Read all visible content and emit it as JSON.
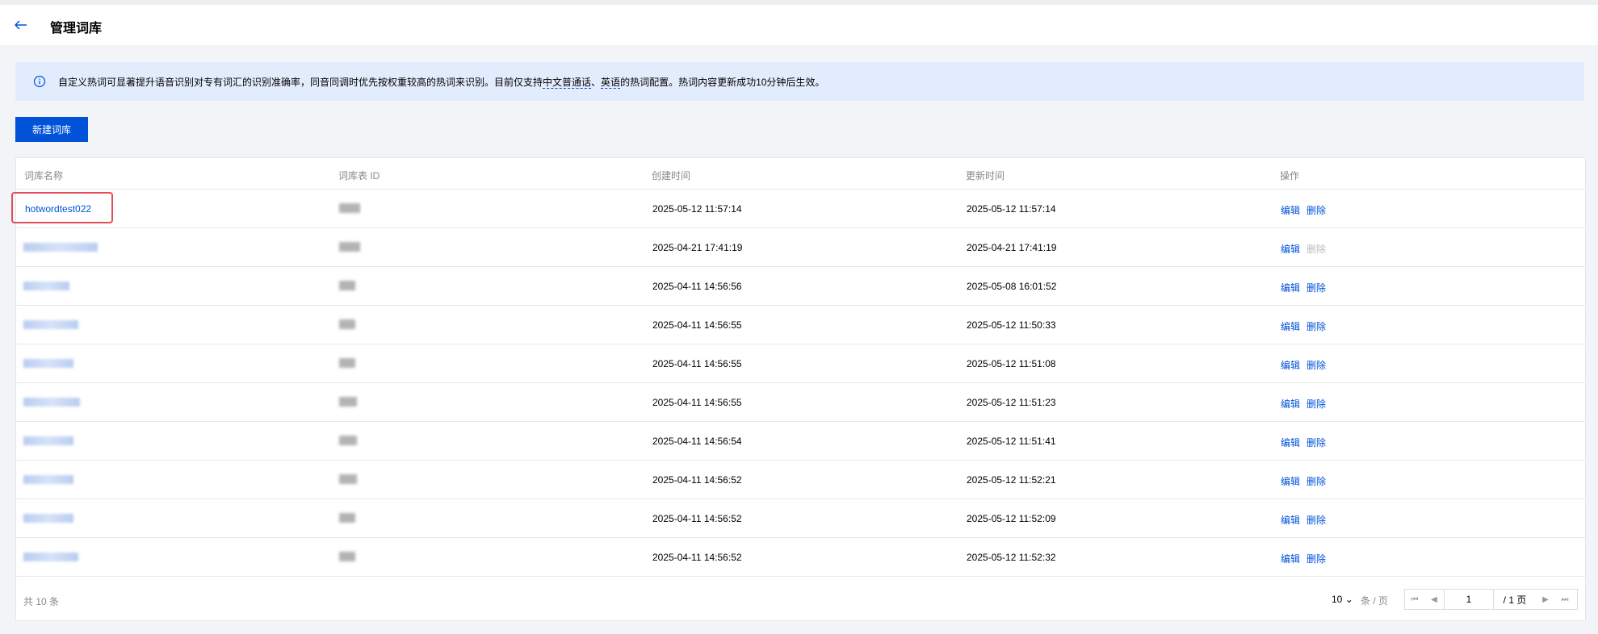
{
  "header": {
    "title": "管理词库"
  },
  "notice": {
    "text_before": "自定义热词可显著提升语音识别对专有词汇的识别准确率，同音同调时优先按权重较高的热词来识别。目前仅支持",
    "lang1": "中文普通话",
    "sep": "、",
    "lang2": "英语",
    "text_after": "的热词配置。热词内容更新成功10分钟后生效。"
  },
  "toolbar": {
    "create_label": "新建词库"
  },
  "table": {
    "columns": [
      "词库名称",
      "词库表 ID",
      "创建时间",
      "更新时间",
      "操作"
    ],
    "rows": [
      {
        "name": "hotwordtest022",
        "created": "2025-05-12 11:57:14",
        "updated": "2025-05-12 11:57:14",
        "edit": "编辑",
        "delete": "删除",
        "delete_disabled": false
      },
      {
        "name": "",
        "created": "2025-04-21 17:41:19",
        "updated": "2025-04-21 17:41:19",
        "edit": "编辑",
        "delete": "删除",
        "delete_disabled": true
      },
      {
        "name": "",
        "created": "2025-04-11 14:56:56",
        "updated": "2025-05-08 16:01:52",
        "edit": "编辑",
        "delete": "删除",
        "delete_disabled": false
      },
      {
        "name": "",
        "created": "2025-04-11 14:56:55",
        "updated": "2025-05-12 11:50:33",
        "edit": "编辑",
        "delete": "删除",
        "delete_disabled": false
      },
      {
        "name": "",
        "created": "2025-04-11 14:56:55",
        "updated": "2025-05-12 11:51:08",
        "edit": "编辑",
        "delete": "删除",
        "delete_disabled": false
      },
      {
        "name": "",
        "created": "2025-04-11 14:56:55",
        "updated": "2025-05-12 11:51:23",
        "edit": "编辑",
        "delete": "删除",
        "delete_disabled": false
      },
      {
        "name": "",
        "created": "2025-04-11 14:56:54",
        "updated": "2025-05-12 11:51:41",
        "edit": "编辑",
        "delete": "删除",
        "delete_disabled": false
      },
      {
        "name": "",
        "created": "2025-04-11 14:56:52",
        "updated": "2025-05-12 11:52:21",
        "edit": "编辑",
        "delete": "删除",
        "delete_disabled": false
      },
      {
        "name": "",
        "created": "2025-04-11 14:56:52",
        "updated": "2025-05-12 11:52:09",
        "edit": "编辑",
        "delete": "删除",
        "delete_disabled": false
      },
      {
        "name": "",
        "created": "2025-04-11 14:56:52",
        "updated": "2025-05-12 11:52:32",
        "edit": "编辑",
        "delete": "删除",
        "delete_disabled": false
      }
    ]
  },
  "pagination": {
    "total": "共 10 条",
    "page_size": "10",
    "per_page_label": "条 / 页",
    "current_page": "1",
    "total_pages": "/ 1 页"
  },
  "colors": {
    "primary": "#0052d9",
    "notice_bg": "#e3ecfd",
    "highlight": "#e34d59"
  }
}
